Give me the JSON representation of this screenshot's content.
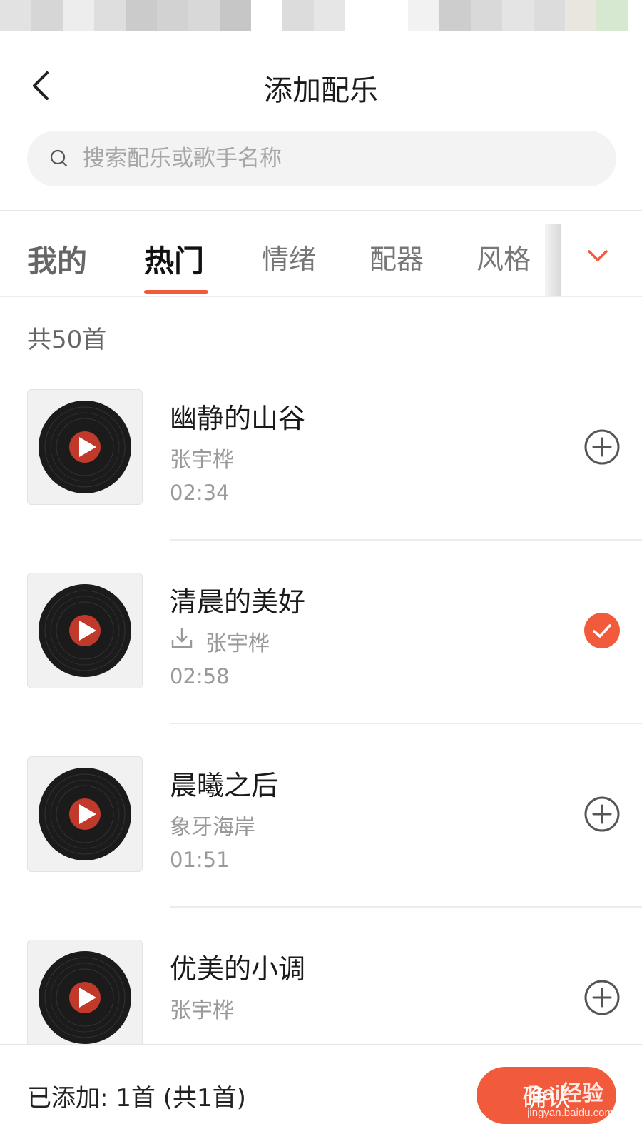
{
  "header": {
    "title": "添加配乐"
  },
  "search": {
    "placeholder": "搜索配乐或歌手名称"
  },
  "tabs": [
    {
      "label": "我的"
    },
    {
      "label": "热门"
    },
    {
      "label": "情绪"
    },
    {
      "label": "配器"
    },
    {
      "label": "风格"
    }
  ],
  "count_label": "共50首",
  "songs": [
    {
      "title": "幽静的山谷",
      "artist": "张宇桦",
      "duration": "02:34",
      "selected": false
    },
    {
      "title": "清晨的美好",
      "artist": "张宇桦",
      "duration": "02:58",
      "selected": true
    },
    {
      "title": "晨曦之后",
      "artist": "象牙海岸",
      "duration": "01:51",
      "selected": false
    },
    {
      "title": "优美的小调",
      "artist": "张宇桦",
      "duration": "",
      "selected": false
    }
  ],
  "footer": {
    "added_text": "已添加: 1首 (共1首)",
    "confirm_label": "确认"
  },
  "watermark": {
    "brand": "Bai经验",
    "url": "jingyan.baidu.com"
  },
  "colors": {
    "accent": "#f15a3a",
    "text_primary": "#1a1a1a",
    "text_secondary": "#999999",
    "search_bg": "#f3f3f3"
  }
}
